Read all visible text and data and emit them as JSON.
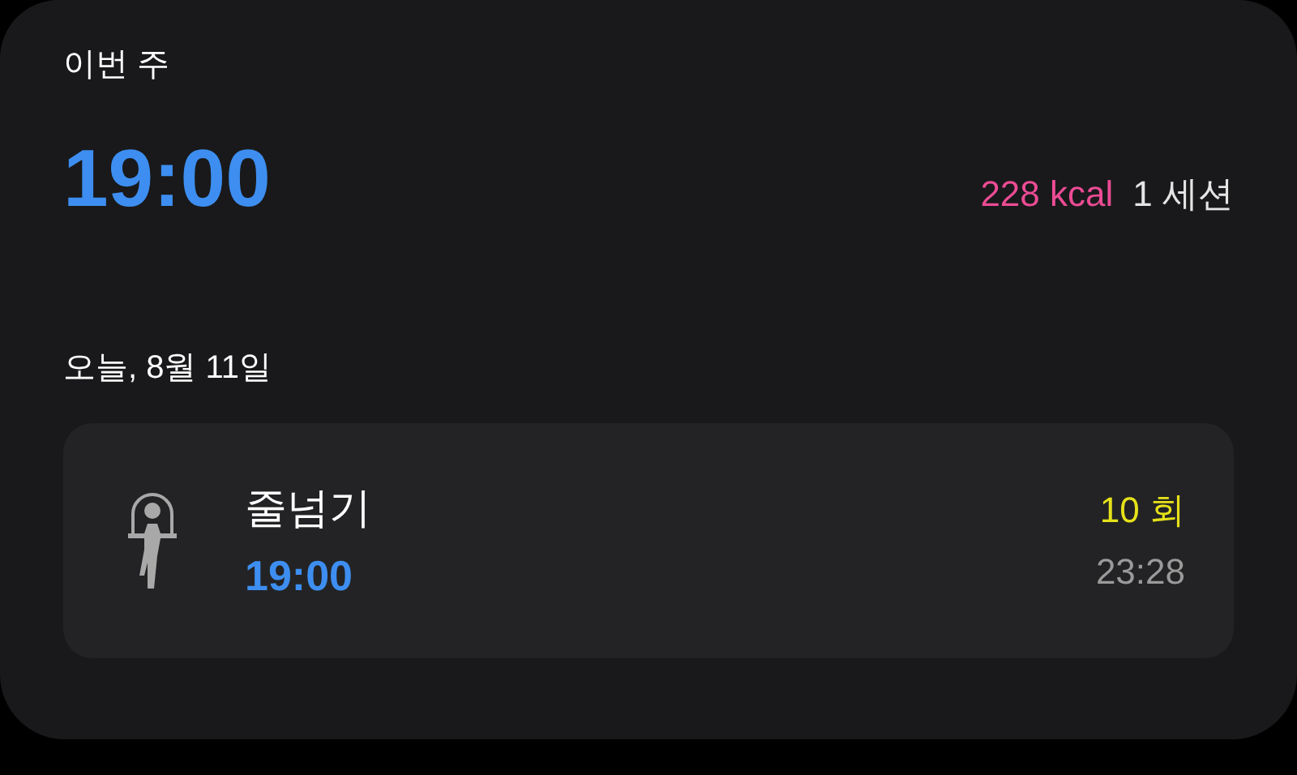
{
  "week": {
    "title": "이번 주",
    "duration": "19:00",
    "calories": "228 kcal",
    "sessions": "1 세션"
  },
  "day": {
    "title": "오늘, 8월 11일"
  },
  "workouts": [
    {
      "name": "줄넘기",
      "duration": "19:00",
      "count": "10 회",
      "time": "23:28"
    }
  ]
}
